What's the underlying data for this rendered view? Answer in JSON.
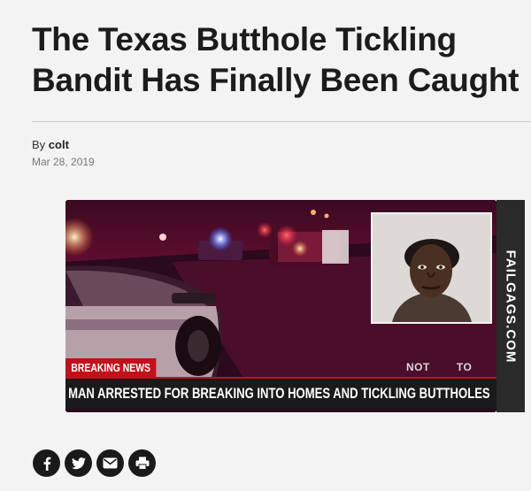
{
  "article": {
    "headline": "The Texas Butthole Tickling Bandit Has Finally Been Caught",
    "byline_prefix": "By",
    "author": "colt",
    "date": "Mar 28, 2019"
  },
  "image": {
    "breaking_tag": "BREAKING NEWS",
    "logo_left": "NOT",
    "logo_right": "TO",
    "ticker_text": "MAN ARRESTED FOR BREAKING INTO HOMES AND TICKLING BUTTHOLES",
    "watermark": "FAILGAGS.COM"
  },
  "share": {
    "buttons": [
      {
        "icon": "facebook-icon"
      },
      {
        "icon": "twitter-icon"
      },
      {
        "icon": "email-icon"
      },
      {
        "icon": "print-icon"
      }
    ]
  }
}
